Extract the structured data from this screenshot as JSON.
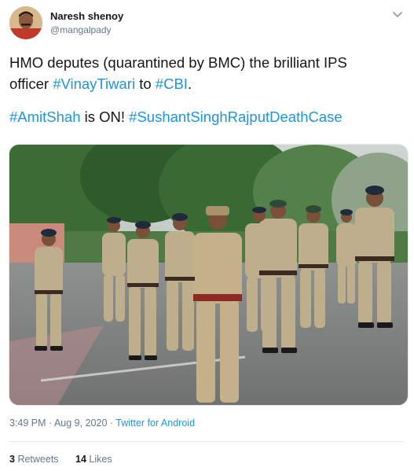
{
  "author": {
    "name": "Naresh shenoy",
    "handle": "@mangalpady"
  },
  "tweet": {
    "line1": "HMO deputes (quarantined by BMC) the brilliant IPS",
    "line2_prefix": "officer ",
    "line2_tag1": "#VinayTiwari",
    "line2_mid": " to ",
    "line2_tag2": "#CBI",
    "line2_suffix": ".",
    "line3_tag1": "#AmitShah",
    "line3_mid": " is ON! ",
    "line3_tag2": "#SushantSinghRajputDeathCase"
  },
  "meta": {
    "time_date": "3:49 PM · Aug 9, 2020 · ",
    "source": "Twitter for Android"
  },
  "stats": {
    "retweets_count": "3",
    "retweets_label": "Retweets",
    "likes_count": "14",
    "likes_label": "Likes"
  },
  "colors": {
    "link": "#1b95e0",
    "text": "#14171a",
    "secondary": "#657786"
  },
  "media": {
    "icon": "photo-police-officers-marching"
  }
}
